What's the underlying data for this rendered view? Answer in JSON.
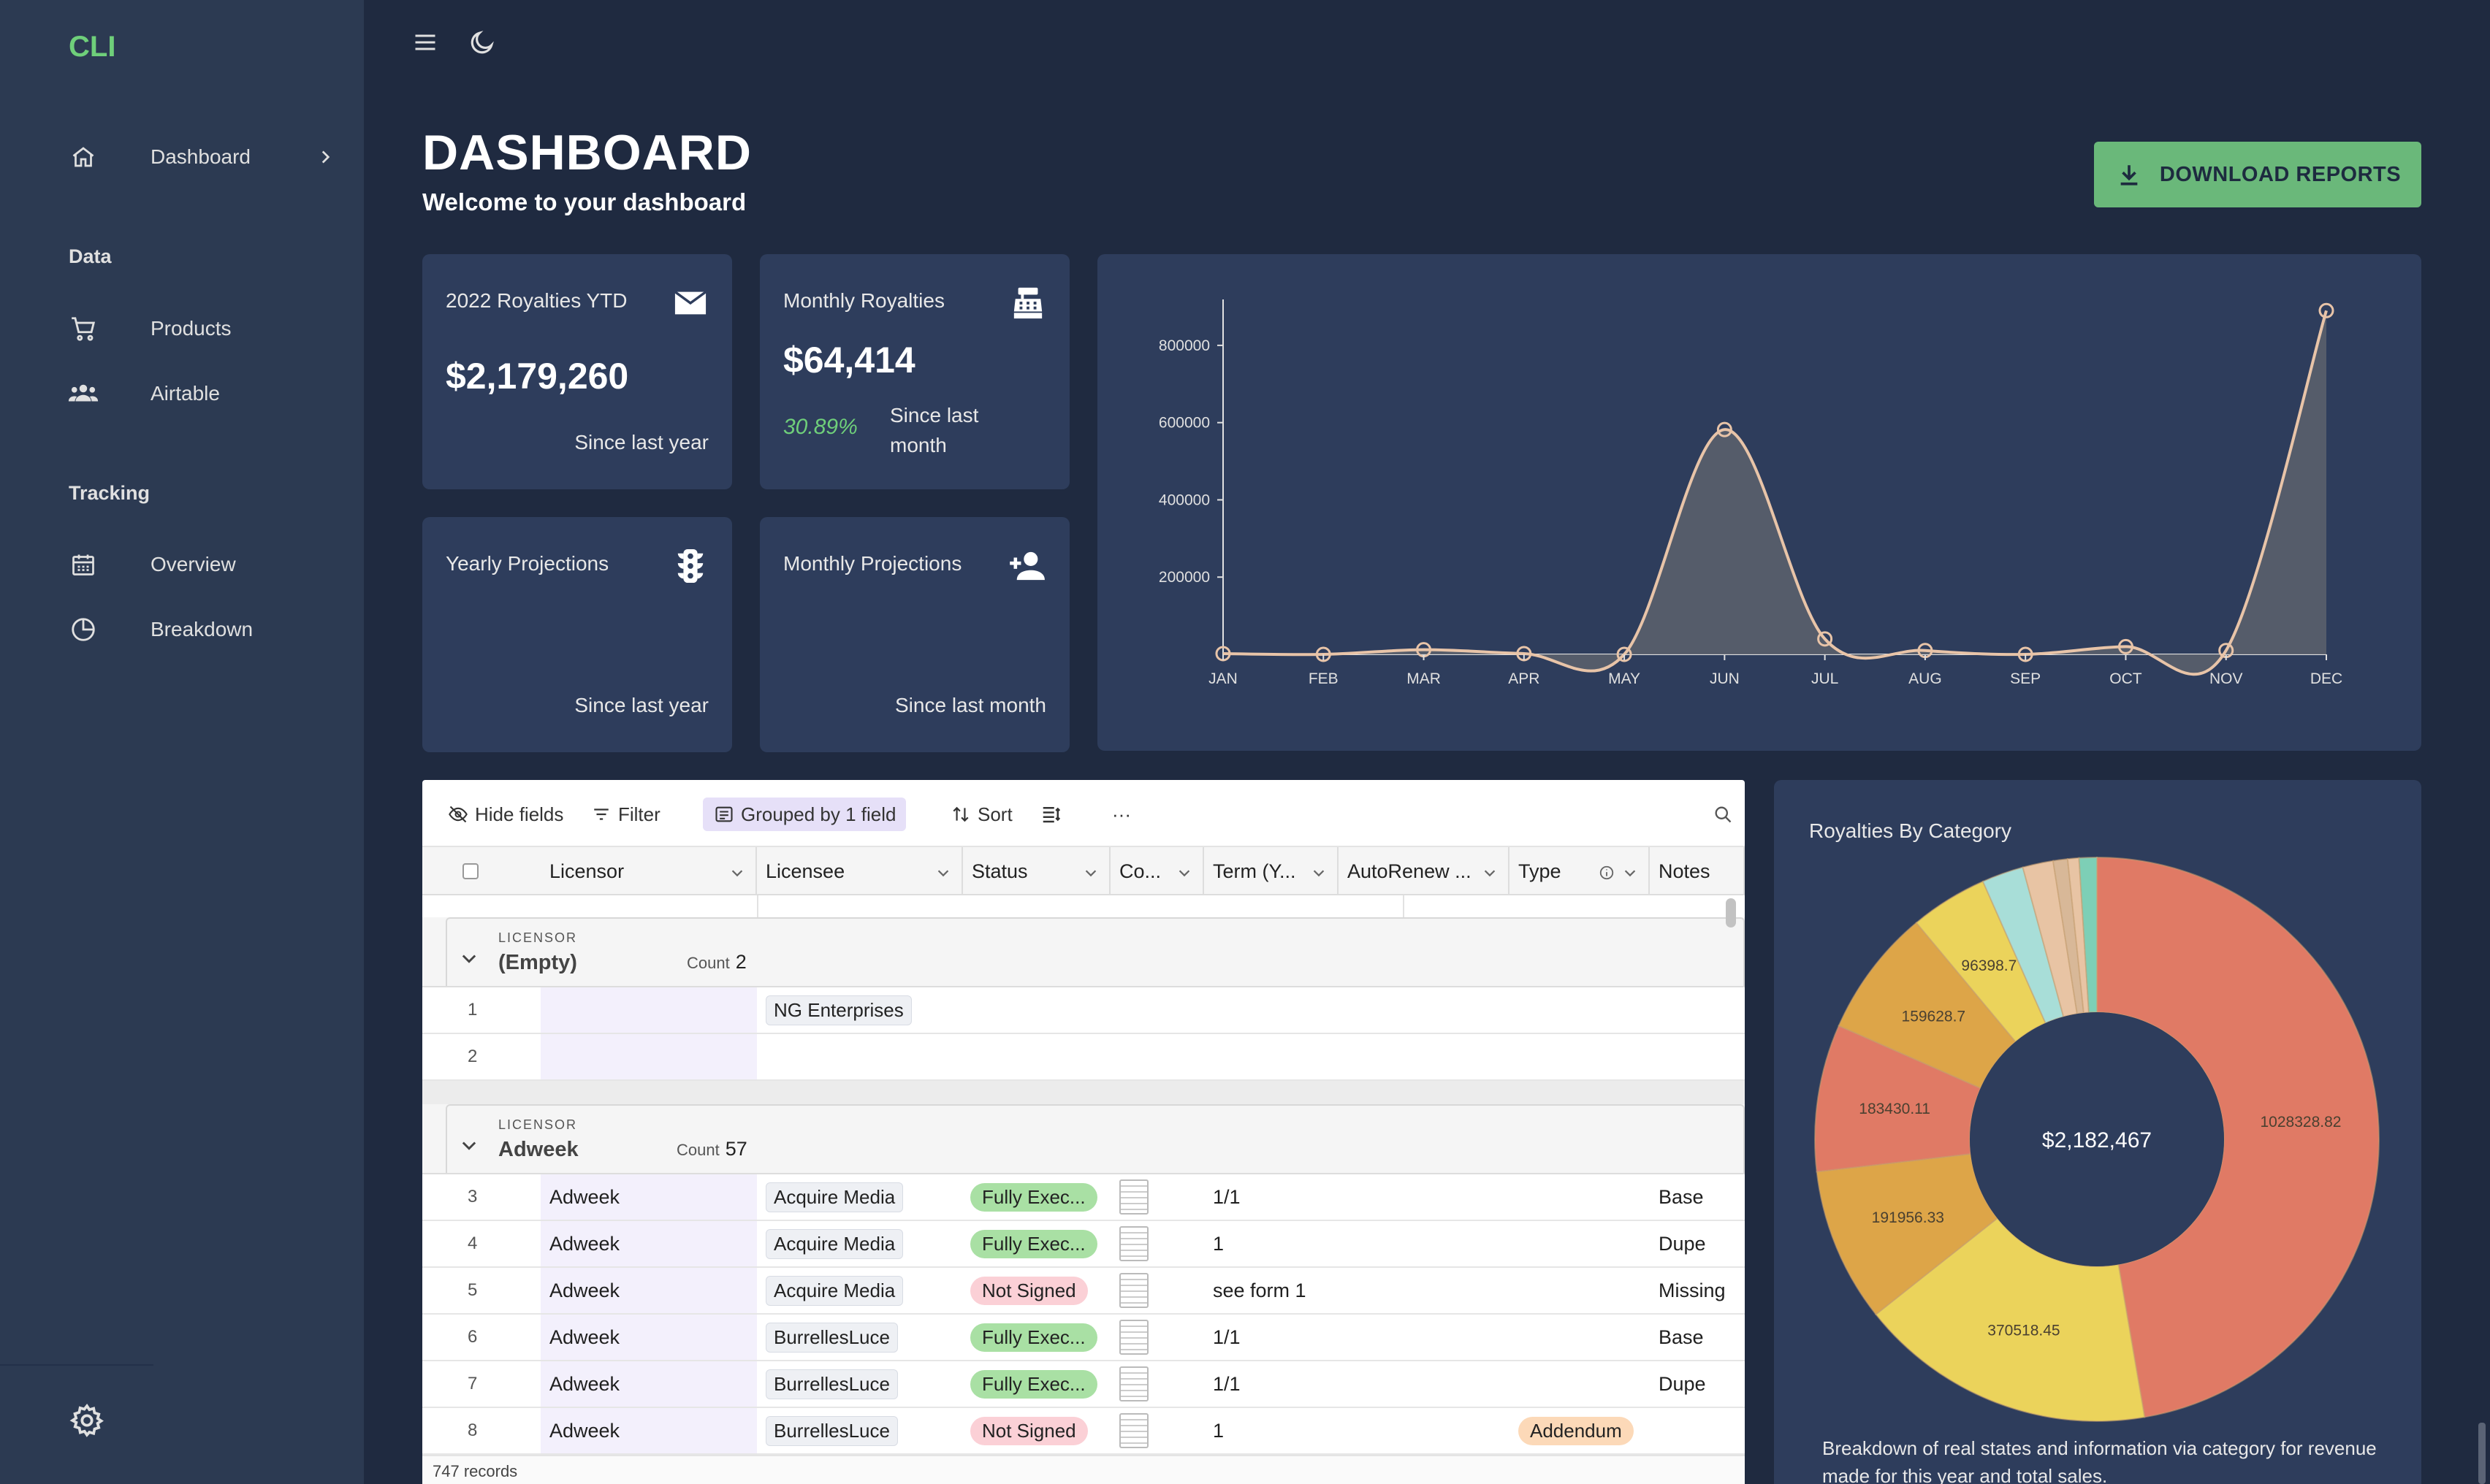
{
  "app": {
    "logo": "CLI"
  },
  "sidebar": {
    "dashboard": "Dashboard",
    "section_data": "Data",
    "products": "Products",
    "airtable": "Airtable",
    "section_tracking": "Tracking",
    "overview": "Overview",
    "breakdown": "Breakdown"
  },
  "header": {
    "title": "DASHBOARD",
    "subtitle": "Welcome to your dashboard",
    "download_label": "DOWNLOAD REPORTS"
  },
  "cards": {
    "royalties_ytd": {
      "title": "2022 Royalties YTD",
      "value": "$2,179,260",
      "sub": "Since last year"
    },
    "monthly_royalties": {
      "title": "Monthly Royalties",
      "value": "$64,414",
      "pct": "30.89%",
      "sub": "Since last month"
    },
    "yearly_projections": {
      "title": "Yearly Projections",
      "sub": "Since last year"
    },
    "monthly_projections": {
      "title": "Monthly Projections",
      "sub": "Since last month"
    }
  },
  "chart_data": [
    {
      "type": "area",
      "title": "",
      "xlabel": "",
      "ylabel": "",
      "categories": [
        "JAN",
        "FEB",
        "MAR",
        "APR",
        "MAY",
        "JUN",
        "JUL",
        "AUG",
        "SEP",
        "OCT",
        "NOV",
        "DEC"
      ],
      "values": [
        2000,
        0,
        12000,
        2000,
        0,
        582000,
        40000,
        10000,
        0,
        20000,
        10000,
        890000
      ],
      "yticks": [
        200000,
        400000,
        600000,
        800000
      ],
      "ylim": [
        0,
        900000
      ],
      "colors": {
        "line": "#e8c4a8",
        "fill": "#5a5f6c"
      }
    },
    {
      "type": "pie",
      "title": "Royalties By Category",
      "center_label": "$2,182,467",
      "slices": [
        {
          "value": 1028328.82,
          "label": "1028328.82",
          "color": "#e07a65"
        },
        {
          "value": 370518.45,
          "label": "370518.45",
          "color": "#ebd35b"
        },
        {
          "value": 191956.33,
          "label": "191956.33",
          "color": "#dda548"
        },
        {
          "value": 183430.11,
          "label": "183430.11",
          "color": "#e07a65"
        },
        {
          "value": 159628.7,
          "label": "159628.7",
          "color": "#dda548"
        },
        {
          "value": 96398.7,
          "label": "96398.7",
          "color": "#ebd35b"
        },
        {
          "value": 52000,
          "label": "",
          "color": "#a8ded8"
        },
        {
          "value": 38000,
          "label": "",
          "color": "#e8c4a4"
        },
        {
          "value": 18000,
          "label": "",
          "color": "#d8b898"
        },
        {
          "value": 14000,
          "label": "",
          "color": "#e8c4a4"
        },
        {
          "value": 22000,
          "label": "",
          "color": "#7dcfb6"
        }
      ],
      "description": "Breakdown of real states and information via category for revenue made for this year and total sales."
    }
  ],
  "grid": {
    "toolbar": {
      "hide_fields": "Hide fields",
      "filter": "Filter",
      "grouped": "Grouped by 1 field",
      "sort": "Sort",
      "more": "···"
    },
    "columns": [
      "Licensor",
      "Licensee",
      "Status",
      "Co...",
      "Term (Y...",
      "AutoRenew ...",
      "Type",
      "Notes"
    ],
    "groups": [
      {
        "caption": "LICENSOR",
        "name": "(Empty)",
        "count_label": "Count",
        "count": "2"
      },
      {
        "caption": "LICENSOR",
        "name": "Adweek",
        "count_label": "Count",
        "count": "57"
      }
    ],
    "rows_empty": [
      {
        "n": "1",
        "licensor": "",
        "licensee": "NG Enterprises"
      },
      {
        "n": "2",
        "licensor": "",
        "licensee": ""
      }
    ],
    "rows_adweek": [
      {
        "n": "3",
        "licensor": "Adweek",
        "licensee": "Acquire Media",
        "status": "Fully Exec...",
        "term": "1/1",
        "type": "",
        "notes": "Base"
      },
      {
        "n": "4",
        "licensor": "Adweek",
        "licensee": "Acquire Media",
        "status": "Fully Exec...",
        "term": "1",
        "type": "",
        "notes": "Dupe"
      },
      {
        "n": "5",
        "licensor": "Adweek",
        "licensee": "Acquire Media",
        "status": "Not Signed",
        "term": "see form 1",
        "type": "",
        "notes": "Missing"
      },
      {
        "n": "6",
        "licensor": "Adweek",
        "licensee": "BurrellesLuce",
        "status": "Fully Exec...",
        "term": "1/1",
        "type": "",
        "notes": "Base"
      },
      {
        "n": "7",
        "licensor": "Adweek",
        "licensee": "BurrellesLuce",
        "status": "Fully Exec...",
        "term": "1/1",
        "type": "",
        "notes": "Dupe"
      },
      {
        "n": "8",
        "licensor": "Adweek",
        "licensee": "BurrellesLuce",
        "status": "Not Signed",
        "term": "1",
        "type": "Addendum",
        "notes": ""
      }
    ],
    "records": "747 records"
  }
}
